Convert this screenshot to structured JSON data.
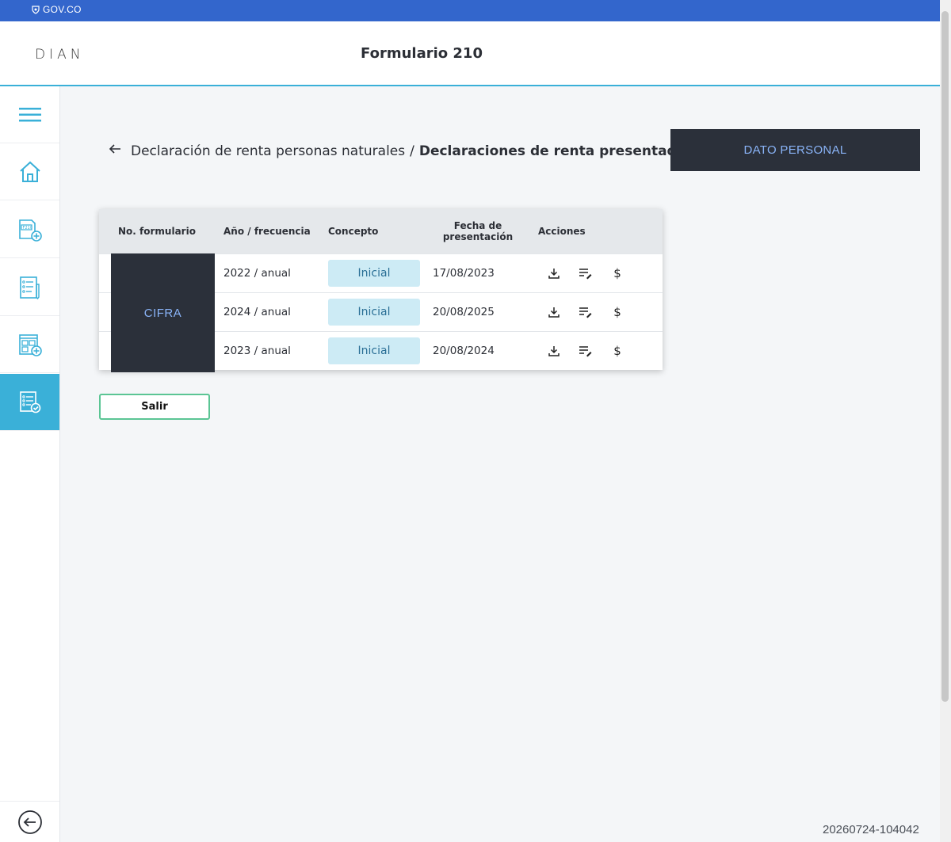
{
  "gov_bar": {
    "label": "GOV.CO"
  },
  "header": {
    "logo": "DIAN",
    "title": "Formulario 210"
  },
  "sidebar": {
    "items": [
      {
        "name": "menu",
        "icon": "hamburger-menu-icon"
      },
      {
        "name": "home",
        "icon": "home-icon"
      },
      {
        "name": "new-form-210",
        "icon": "form-210-add-icon"
      },
      {
        "name": "form-list",
        "icon": "form-list-edit-icon"
      },
      {
        "name": "grid-add",
        "icon": "grid-add-icon"
      },
      {
        "name": "presented",
        "icon": "form-check-icon",
        "active": true
      }
    ],
    "back_icon": "back-circle-icon"
  },
  "breadcrumb": {
    "parent": "Declaración de renta personas naturales",
    "separator": "/",
    "current": "Declaraciones de renta presentadas"
  },
  "dato_personal": "DATO PERSONAL",
  "table": {
    "headers": {
      "numero": "No. formulario",
      "anio": "Año / frecuencia",
      "concepto": "Concepto",
      "fecha_l1": "Fecha de",
      "fecha_l2": "presentación",
      "acciones": "Acciones"
    },
    "redacted_label": "CIFRA",
    "rows": [
      {
        "anio": "2022 / anual",
        "concepto": "Inicial",
        "fecha": "17/08/2023"
      },
      {
        "anio": "2024 / anual",
        "concepto": "Inicial",
        "fecha": "20/08/2025"
      },
      {
        "anio": "2023 / anual",
        "concepto": "Inicial",
        "fecha": "20/08/2024"
      }
    ],
    "action_icons": [
      "download-icon",
      "edit-list-icon",
      "dollar-icon"
    ],
    "dollar_symbol": "$"
  },
  "buttons": {
    "salir": "Salir"
  },
  "timestamp": "20260724-104042",
  "colors": {
    "gov_blue": "#3366cc",
    "accent": "#3ab0d8",
    "redaction": "#2b303a",
    "redaction_text": "#8ab4f8",
    "pill_bg": "#cdebf5",
    "salir_border": "#5bc594"
  }
}
